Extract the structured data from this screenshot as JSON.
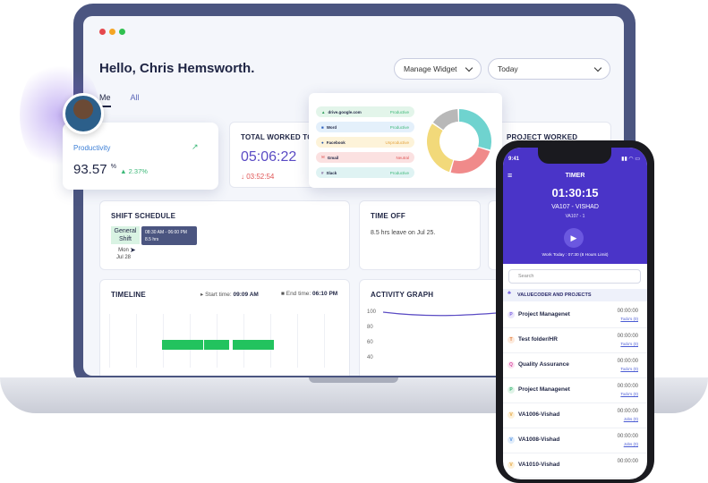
{
  "colors": {
    "accent": "#4a34c8",
    "productive": "#3cb878",
    "unproductive": "#e3a23b",
    "neutral": "#e05757",
    "timeline_bar": "#22c35e"
  },
  "greeting": "Hello, Chris Hemsworth.",
  "manage_widget": "Manage Widget",
  "date_select": "Today",
  "tabs": [
    "Me",
    "All"
  ],
  "productivity": {
    "title": "Productivity",
    "value": "93.57",
    "unit": "%",
    "change": "2.37%",
    "trend_icon": "trend-up-icon"
  },
  "total_worked": {
    "title": "TOTAL WORKED TO",
    "value": "05:06:22",
    "delta": "03:52:54"
  },
  "project_worked": {
    "title": "PROJECT WORKED"
  },
  "apps": [
    {
      "name": "drive.google.com",
      "status": "Productive",
      "bg": "#e3f5ea",
      "fg": "#3cb878",
      "icon_color": "#2f9e5a"
    },
    {
      "name": "Word",
      "status": "Productive",
      "bg": "#e4f0fb",
      "fg": "#3cb878",
      "icon_color": "#2b5fbd"
    },
    {
      "name": "Facebook",
      "status": "Unproductive",
      "bg": "#fdf3d9",
      "fg": "#e3a23b",
      "icon_color": "#1f4fa3"
    },
    {
      "name": "Gmail",
      "status": "Neutral",
      "bg": "#fbe1e1",
      "fg": "#e05757",
      "icon_color": "#d93a3a"
    },
    {
      "name": "Slack",
      "status": "Productive",
      "bg": "#dff3f3",
      "fg": "#3cb878",
      "icon_color": "#5b2a78"
    }
  ],
  "donut": [
    {
      "name": "Productive",
      "value": 30,
      "color": "#6fd3cf"
    },
    {
      "name": "Neutral",
      "value": 25,
      "color": "#f08a8a"
    },
    {
      "name": "Unproductive",
      "value": 30,
      "color": "#f2d97a"
    },
    {
      "name": "Other",
      "value": 15,
      "color": "#b8b8b8"
    }
  ],
  "shift": {
    "title": "SHIFT SCHEDULE",
    "label_line1": "General",
    "label_line2": "Shift",
    "tooltip_time": "08:30 AM - 06:00 PM",
    "tooltip_hours": "8.5 hrs",
    "day": "Mon",
    "date": "Jul 28"
  },
  "time_off": {
    "title": "TIME OFF",
    "text": "8.5 hrs leave on Jul 25."
  },
  "timeline": {
    "title": "TIMELINE",
    "start_label": "Start time:",
    "start_value": "09:09 AM",
    "end_label": "End time:",
    "end_value": "06:10 PM"
  },
  "activity": {
    "title": "ACTIVITY GRAPH",
    "ticks": [
      "100",
      "80",
      "60",
      "40"
    ]
  },
  "phone": {
    "time": "9:41",
    "timer_title": "TIMER",
    "timer_value": "01:30:15",
    "user": "VA107 - VISHAD",
    "user_sub": "VA107 - 1",
    "work_today": "Work Today : 07:30 (8 Hours Limit)",
    "search_placeholder": "Search",
    "section": "VALUECODER AND PROJECTS",
    "projects": [
      {
        "letter": "P",
        "name": "Project Managenet",
        "time": "00:00:00",
        "link": "Todo's (0)",
        "color": "#7b5fe0",
        "bg": "#ebe6fb"
      },
      {
        "letter": "T",
        "name": "Test folder/HR",
        "time": "00:00:00",
        "link": "Todo's (0)",
        "color": "#e07b39",
        "bg": "#fdeadd"
      },
      {
        "letter": "Q",
        "name": "Quality Assurance",
        "time": "00:00:00",
        "link": "Todo's (0)",
        "color": "#d64aa0",
        "bg": "#fbe2f1"
      },
      {
        "letter": "P",
        "name": "Project Managenet",
        "time": "00:00:00",
        "link": "Todo's (0)",
        "color": "#3cb878",
        "bg": "#dff3e7"
      },
      {
        "letter": "V",
        "name": "VA1006-Vishad",
        "time": "00:00:00",
        "link": "Jobs (0)",
        "color": "#e3a23b",
        "bg": "#fdf1da"
      },
      {
        "letter": "V",
        "name": "VA1008-Vishad",
        "time": "00:00:00",
        "link": "Jobs (0)",
        "color": "#4a8de0",
        "bg": "#e1edfb"
      },
      {
        "letter": "V",
        "name": "VA1010-Vishad",
        "time": "00:00:00",
        "link": "",
        "color": "#e3a23b",
        "bg": "#fdf1da"
      }
    ]
  }
}
